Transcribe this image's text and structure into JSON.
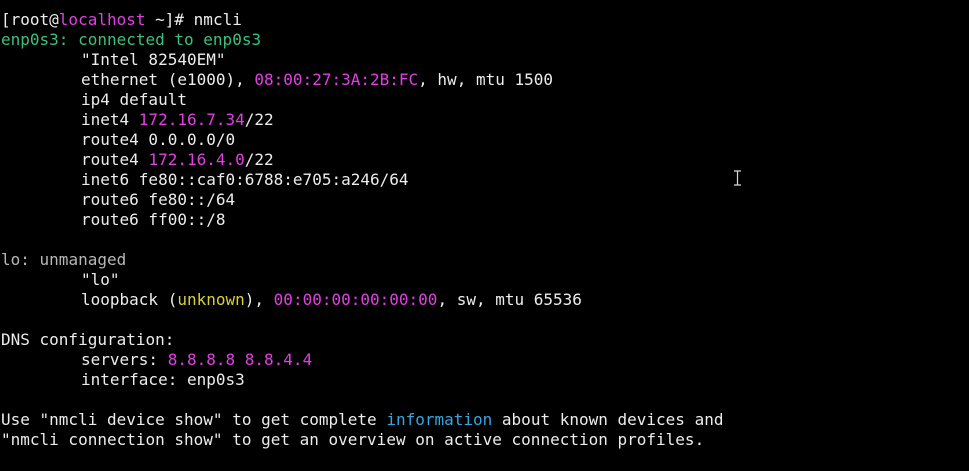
{
  "prompt": {
    "prefix": "[root@",
    "host": "localhost",
    "suffix": " ~]# ",
    "command": "nmcli"
  },
  "enp0s3": {
    "header": "enp0s3: connected to enp0s3",
    "model": "\"Intel 82540EM\"",
    "ethernet_prefix": "ethernet (e1000), ",
    "mac": "08:00:27:3A:2B:FC",
    "ethernet_suffix": ", hw, mtu 1500",
    "ip4_default": "ip4 default",
    "inet4_label": "inet4 ",
    "inet4_addr": "172.16.7.34",
    "inet4_mask": "/22",
    "route4_a": "route4 0.0.0.0/0",
    "route4_b_label": "route4 ",
    "route4_b_addr": "172.16.4.0",
    "route4_b_mask": "/22",
    "inet6": "inet6 fe80::caf0:6788:e705:a246/64",
    "route6_a": "route6 fe80::/64",
    "route6_b": "route6 ff00::/8"
  },
  "lo": {
    "name": "lo:",
    "state": " unmanaged",
    "alias": "\"lo\"",
    "loopback_prefix": "loopback (",
    "unknown": "unknown",
    "loopback_mid": "), ",
    "mac": "00:00:00:00:00:00",
    "loopback_suffix": ", sw, mtu 65536"
  },
  "dns": {
    "header": "DNS configuration:",
    "servers_label": "servers: ",
    "servers": "8.8.8.8 8.8.4.4",
    "interface": "interface: enp0s3"
  },
  "help": {
    "line1_pre": "Use \"nmcli device show\" to get complete ",
    "line1_word": "information",
    "line1_post": " about known devices and",
    "line2": "\"nmcli connection show\" to get an overview on active connection profiles."
  },
  "colors": {
    "background": "#000000",
    "foreground": "#ececec",
    "magenta": "#e040e0",
    "green": "#3cc17c",
    "gray": "#b7b7b7",
    "yellow": "#d8d03a",
    "cyan": "#33a7e2"
  },
  "icons": {
    "cursor": "text-ibeam-cursor-icon"
  }
}
